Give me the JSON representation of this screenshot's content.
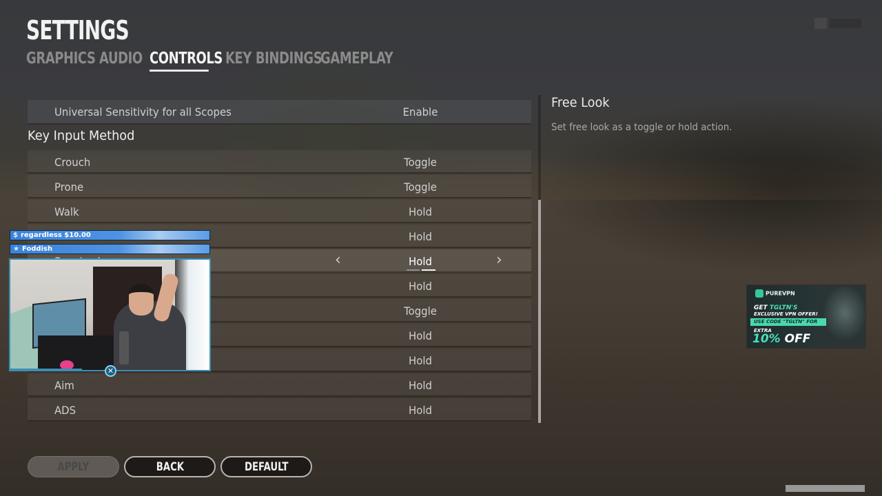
{
  "header": {
    "title": "SETTINGS",
    "tabs": [
      {
        "label": "GRAPHICS",
        "active": false
      },
      {
        "label": "AUDIO",
        "active": false
      },
      {
        "label": "CONTROLS",
        "active": true
      },
      {
        "label": "KEY BINDINGS",
        "active": false
      },
      {
        "label": "GAMEPLAY",
        "active": false
      }
    ]
  },
  "settings": {
    "top_rows": [
      {
        "label": "Universal Sensitivity for all Scopes",
        "value": "Enable"
      }
    ],
    "section_title": "Key Input Method",
    "rows": [
      {
        "label": "Crouch",
        "value": "Toggle"
      },
      {
        "label": "Prone",
        "value": "Toggle"
      },
      {
        "label": "Walk",
        "value": "Hold"
      },
      {
        "label": "",
        "value": "Hold"
      },
      {
        "label": "Free Look",
        "value": "Hold",
        "selected": true
      },
      {
        "label": "",
        "value": "Hold"
      },
      {
        "label": "",
        "value": "Toggle"
      },
      {
        "label": "",
        "value": "Hold"
      },
      {
        "label": "",
        "value": "Hold"
      },
      {
        "label": "Aim",
        "value": "Hold"
      },
      {
        "label": "ADS",
        "value": "Hold"
      }
    ],
    "selected_arrows": {
      "prev": "‹",
      "next": "›"
    },
    "scroll_position_fraction": 0.32
  },
  "description": {
    "title": "Free Look",
    "text": "Set free look as a toggle or hold action."
  },
  "buttons": {
    "apply": "APPLY",
    "back": "BACK",
    "default": "DEFAULT"
  },
  "stream_overlay": {
    "alerts": [
      {
        "icon": "$",
        "text": "regardless $10.00"
      },
      {
        "icon": "★",
        "text": "Foddish"
      }
    ],
    "logo_glyph": "✕"
  },
  "ad": {
    "brand": "PUREVPN",
    "line1_prefix": "GET ",
    "line1_highlight": "TGLTN'S",
    "line2": "EXCLUSIVE VPN OFFER!",
    "code_line": "USE CODE \"TGLTN\" FOR",
    "line3": "EXTRA",
    "discount_pct": "10%",
    "discount_suffix": " OFF",
    "accent_color": "#49e0b6"
  }
}
